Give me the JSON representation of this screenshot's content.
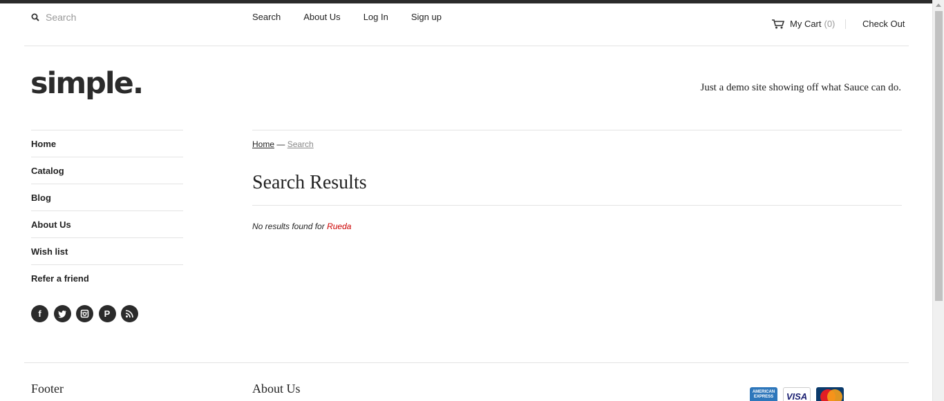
{
  "search": {
    "placeholder": "Search"
  },
  "topnav": [
    "Search",
    "About Us",
    "Log In",
    "Sign up"
  ],
  "cart": {
    "label": "My Cart",
    "count": "(0)",
    "checkout": "Check Out"
  },
  "logo": "simple.",
  "tagline": "Just a demo site showing off what Sauce can do.",
  "sidenav": [
    "Home",
    "Catalog",
    "Blog",
    "About Us",
    "Wish list",
    "Refer a friend"
  ],
  "social": [
    "facebook-icon",
    "twitter-icon",
    "instagram-icon",
    "pinterest-icon",
    "rss-icon"
  ],
  "breadcrumb": {
    "home": "Home",
    "separator": "—",
    "current": "Search"
  },
  "main": {
    "title": "Search Results",
    "no_results_text": "No results found for",
    "search_term": "Rueda"
  },
  "footer": {
    "col1_title": "Footer",
    "col2_title": "About Us"
  },
  "payment_cards": [
    "AMERICAN EXPRESS",
    "VISA",
    "MasterCard"
  ],
  "colors": {
    "accent_term": "#cc0000",
    "topbar": "#2b2b2b"
  }
}
